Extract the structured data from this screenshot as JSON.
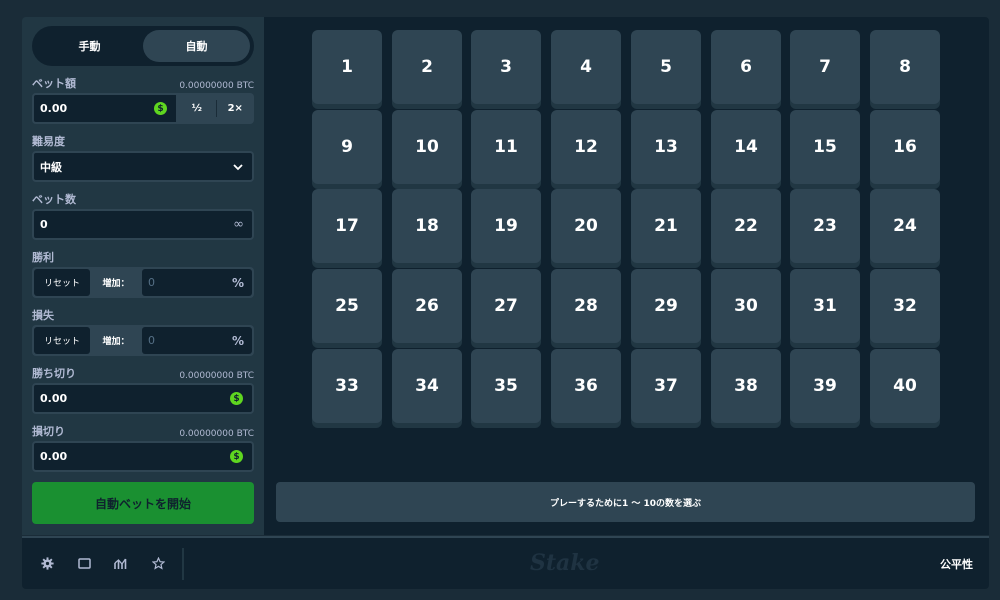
{
  "mode_toggle": {
    "manual": "手動",
    "auto": "自動",
    "active": "auto"
  },
  "bet_amount": {
    "label": "ベット額",
    "balance": "0.00000000 BTC",
    "value": "0.00",
    "half": "½",
    "double": "2×",
    "currency_icon": "dollar-coin-icon"
  },
  "difficulty": {
    "label": "難易度",
    "value": "中級"
  },
  "bet_count": {
    "label": "ベット数",
    "value": "0",
    "icon": "infinity-icon"
  },
  "on_win": {
    "label": "勝利",
    "reset": "リセット",
    "increase": "増加：",
    "value": "0",
    "unit": "%"
  },
  "on_loss": {
    "label": "損失",
    "reset": "リセット",
    "increase": "増加：",
    "value": "0",
    "unit": "%"
  },
  "stop_profit": {
    "label": "勝ち切り",
    "balance": "0.00000000 BTC",
    "value": "0.00"
  },
  "stop_loss": {
    "label": "損切り",
    "balance": "0.00000000 BTC",
    "value": "0.00"
  },
  "start_button": "自動ベットを開始",
  "tiles": [
    "1",
    "2",
    "3",
    "4",
    "5",
    "6",
    "7",
    "8",
    "9",
    "10",
    "11",
    "12",
    "13",
    "14",
    "15",
    "16",
    "17",
    "18",
    "19",
    "20",
    "21",
    "22",
    "23",
    "24",
    "25",
    "26",
    "27",
    "28",
    "29",
    "30",
    "31",
    "32",
    "33",
    "34",
    "35",
    "36",
    "37",
    "38",
    "39",
    "40"
  ],
  "info_message": "プレーするために1 〜 10の数を選ぶ",
  "footer": {
    "logo": "Stake",
    "fairness": "公平性",
    "icons": [
      "gear-icon",
      "theatre-icon",
      "stats-icon",
      "star-icon"
    ]
  },
  "colors": {
    "accent_green": "#1a9031",
    "coin_green": "#5fd620",
    "tile": "#2f4553",
    "panel": "#213743",
    "background": "#0f212e"
  }
}
